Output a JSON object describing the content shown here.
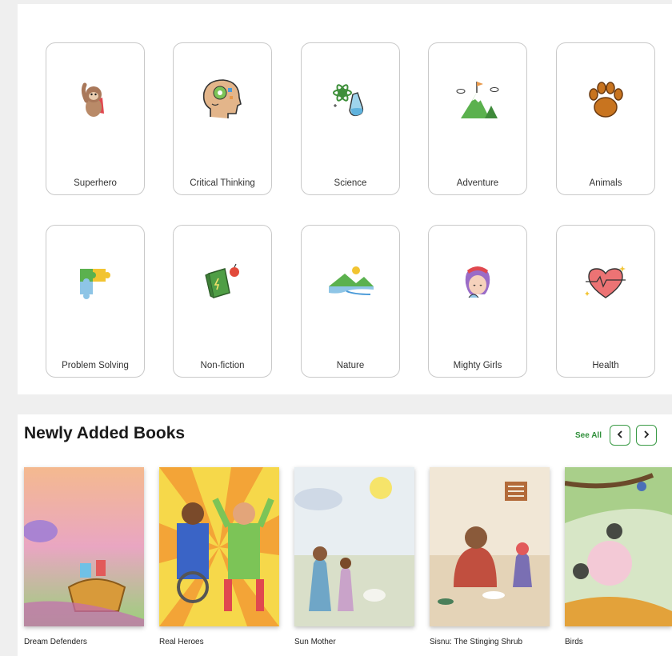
{
  "categories": [
    {
      "label": "Superhero",
      "icon": "sloth-superhero-icon"
    },
    {
      "label": "Critical Thinking",
      "icon": "brain-gear-icon"
    },
    {
      "label": "Science",
      "icon": "atom-flask-icon"
    },
    {
      "label": "Adventure",
      "icon": "mountain-flag-icon"
    },
    {
      "label": "Animals",
      "icon": "paw-print-icon"
    },
    {
      "label": "Problem Solving",
      "icon": "puzzle-icon"
    },
    {
      "label": "Non-fiction",
      "icon": "book-apple-icon"
    },
    {
      "label": "Nature",
      "icon": "landscape-river-icon"
    },
    {
      "label": "Mighty Girls",
      "icon": "girl-face-icon"
    },
    {
      "label": "Health",
      "icon": "heartbeat-icon"
    }
  ],
  "books_section": {
    "title": "Newly Added Books",
    "see_all": "See All",
    "prev_icon": "chevron-left-icon",
    "next_icon": "chevron-right-icon",
    "books": [
      {
        "title": "Dream Defenders"
      },
      {
        "title": "Real Heroes"
      },
      {
        "title": "Sun Mother"
      },
      {
        "title": "Sisnu: The Stinging Shrub"
      },
      {
        "title": "Birds"
      }
    ]
  },
  "colors": {
    "accent": "#3a9a46",
    "card_border": "#c9c9c9",
    "page_bg": "#efefef"
  }
}
